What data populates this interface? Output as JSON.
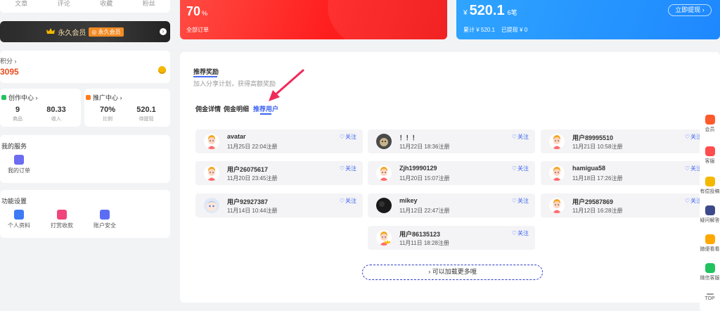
{
  "profile_stats": {
    "labels": [
      "文章",
      "评论",
      "收藏",
      "粉丝"
    ]
  },
  "vip": {
    "text": "永久会员",
    "badge": "◎ 永久会员",
    "arrow": "›"
  },
  "points": {
    "label": "积分 ›",
    "value": "3095"
  },
  "create_center": {
    "title": "创作中心 ›",
    "items": [
      {
        "value": "9",
        "label": "商品"
      },
      {
        "value": "80.33",
        "label": "收入"
      }
    ]
  },
  "promote_center": {
    "title": "推广中心 ›",
    "items": [
      {
        "value": "70%",
        "label": "比例"
      },
      {
        "value": "520.1",
        "label": "待提现"
      }
    ]
  },
  "service": {
    "title": "我的服务",
    "items": [
      {
        "label": "我的订单",
        "icon": "clipboard-icon"
      }
    ]
  },
  "settings": {
    "title": "功能设置",
    "items": [
      {
        "label": "个人资料",
        "icon": "user-profile-icon"
      },
      {
        "label": "打赏收款",
        "icon": "gift-icon"
      },
      {
        "label": "账户安全",
        "icon": "shield-icon"
      }
    ]
  },
  "orders_banner": {
    "value": "70",
    "unit": "%",
    "label": "全部订单"
  },
  "earn_banner": {
    "currency": "¥",
    "value": "520.1",
    "count": "6笔",
    "total": "累计 ¥ 520.1",
    "withdrawn": "已提现 ¥ 0",
    "button": "立即提现 ›"
  },
  "reward": {
    "title": "推荐奖励",
    "desc": "加入分享计划，获得高额奖励"
  },
  "tabs": [
    {
      "label": "佣金详情",
      "active": false
    },
    {
      "label": "佣金明细",
      "active": false
    },
    {
      "label": "推荐用户",
      "active": true
    }
  ],
  "follow_label": "关注",
  "users": [
    {
      "name": "avatar",
      "date": "11月25日 22:04注册",
      "avatar": "cartoon"
    },
    {
      "name": "！！！",
      "date": "11月22日 18:36注册",
      "avatar": "photo-cat"
    },
    {
      "name": "用户89995510",
      "date": "11月21日 10:58注册",
      "avatar": "cartoon"
    },
    {
      "name": "用户26075617",
      "date": "11月20日 23:45注册",
      "avatar": "cartoon"
    },
    {
      "name": "Zjh19990129",
      "date": "11月20日 15:07注册",
      "avatar": "cartoon"
    },
    {
      "name": "hamigua58",
      "date": "11月18日 17:26注册",
      "avatar": "cartoon"
    },
    {
      "name": "用户92927387",
      "date": "11月14日 10:44注册",
      "avatar": "anime"
    },
    {
      "name": "mikey",
      "date": "11月12日 22:47注册",
      "avatar": "photo-dark"
    },
    {
      "name": "用户29587869",
      "date": "11月12日 16:28注册",
      "avatar": "cartoon"
    },
    {
      "name": "用户86135123",
      "date": "11月11日 18:28注册",
      "avatar": "cartoon-vip"
    }
  ],
  "load_more": "›    可以加载更多哦",
  "toolbar": [
    {
      "label": "会员",
      "icon": "vip-icon",
      "color": "#ff5a2c"
    },
    {
      "label": "客服",
      "icon": "customer-service-icon",
      "color": "#ff4d4d"
    },
    {
      "label": "有偿投稿",
      "icon": "submit-icon",
      "color": "#f5b800"
    },
    {
      "label": "疑问解答",
      "icon": "faq-icon",
      "color": "#3d4a8a"
    },
    {
      "label": "随便看看",
      "icon": "browse-icon",
      "color": "#ffa800"
    },
    {
      "label": "微信客服",
      "icon": "wechat-icon",
      "color": "#22c25f"
    },
    {
      "label": "TOP",
      "icon": "back-to-top-icon",
      "color": "#999999"
    }
  ],
  "colors": {
    "accent": "#3b63f1",
    "red": "#ff2a2a",
    "blue": "#1e88ff",
    "orange": "#e94b1f"
  }
}
